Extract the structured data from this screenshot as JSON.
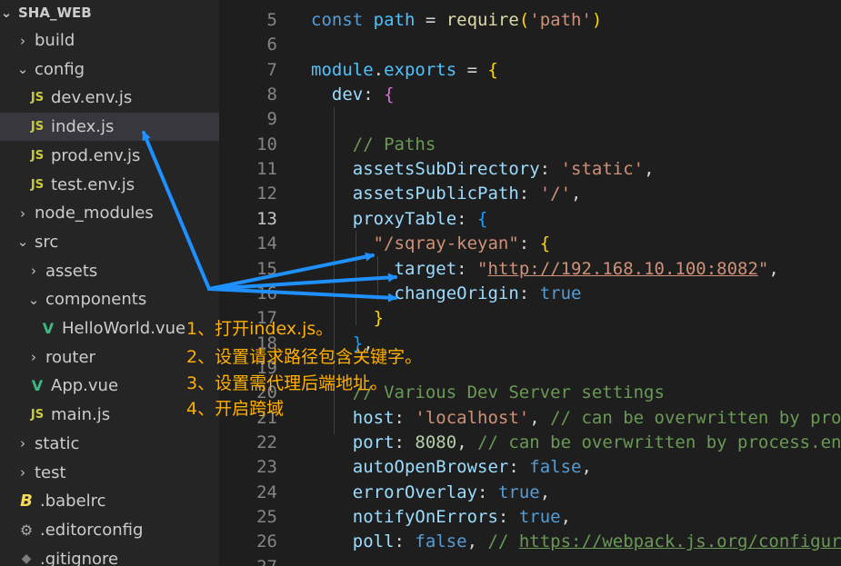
{
  "explorer": {
    "root": "SHA_WEB",
    "items": [
      {
        "label": "build",
        "type": "folder",
        "open": false,
        "indent": 0
      },
      {
        "label": "config",
        "type": "folder",
        "open": true,
        "indent": 0
      },
      {
        "label": "dev.env.js",
        "type": "js",
        "indent": 1
      },
      {
        "label": "index.js",
        "type": "js",
        "indent": 1,
        "selected": true
      },
      {
        "label": "prod.env.js",
        "type": "js",
        "indent": 1
      },
      {
        "label": "test.env.js",
        "type": "js",
        "indent": 1
      },
      {
        "label": "node_modules",
        "type": "folder",
        "open": false,
        "indent": 0
      },
      {
        "label": "src",
        "type": "folder",
        "open": true,
        "indent": 0
      },
      {
        "label": "assets",
        "type": "folder",
        "open": false,
        "indent": 1
      },
      {
        "label": "components",
        "type": "folder",
        "open": true,
        "indent": 1
      },
      {
        "label": "HelloWorld.vue",
        "type": "vue",
        "indent": 2
      },
      {
        "label": "router",
        "type": "folder",
        "open": false,
        "indent": 1
      },
      {
        "label": "App.vue",
        "type": "vue",
        "indent": 1
      },
      {
        "label": "main.js",
        "type": "js",
        "indent": 1
      },
      {
        "label": "static",
        "type": "folder",
        "open": false,
        "indent": 0
      },
      {
        "label": "test",
        "type": "folder",
        "open": false,
        "indent": 0
      },
      {
        "label": ".babelrc",
        "type": "babel",
        "indent": 0
      },
      {
        "label": ".editorconfig",
        "type": "gear",
        "indent": 0
      },
      {
        "label": ".gitignore",
        "type": "git",
        "indent": 0
      }
    ]
  },
  "editor": {
    "active_line": 13,
    "lines": [
      {
        "n": 5,
        "tokens": [
          [
            "kw",
            "const "
          ],
          [
            "var",
            "path"
          ],
          [
            "pun",
            " = "
          ],
          [
            "fn",
            "require"
          ],
          [
            "br1",
            "("
          ],
          [
            "str",
            "'path'"
          ],
          [
            "br1",
            ")"
          ]
        ]
      },
      {
        "n": 6,
        "tokens": []
      },
      {
        "n": 7,
        "tokens": [
          [
            "var",
            "module"
          ],
          [
            "pun",
            "."
          ],
          [
            "var",
            "exports"
          ],
          [
            "pun",
            " = "
          ],
          [
            "br1",
            "{"
          ]
        ]
      },
      {
        "n": 8,
        "tokens": [
          [
            "pun",
            "  "
          ],
          [
            "prop",
            "dev"
          ],
          [
            "pun",
            ": "
          ],
          [
            "br2",
            "{"
          ]
        ]
      },
      {
        "n": 9,
        "tokens": []
      },
      {
        "n": 10,
        "tokens": [
          [
            "pun",
            "    "
          ],
          [
            "cmt",
            "// Paths"
          ]
        ]
      },
      {
        "n": 11,
        "tokens": [
          [
            "pun",
            "    "
          ],
          [
            "prop",
            "assetsSubDirectory"
          ],
          [
            "pun",
            ": "
          ],
          [
            "str",
            "'static'"
          ],
          [
            "pun",
            ","
          ]
        ]
      },
      {
        "n": 12,
        "tokens": [
          [
            "pun",
            "    "
          ],
          [
            "prop",
            "assetsPublicPath"
          ],
          [
            "pun",
            ": "
          ],
          [
            "str",
            "'/'"
          ],
          [
            "pun",
            ","
          ]
        ]
      },
      {
        "n": 13,
        "tokens": [
          [
            "pun",
            "    "
          ],
          [
            "prop",
            "proxyTable"
          ],
          [
            "pun",
            ": "
          ],
          [
            "br3",
            "{"
          ]
        ]
      },
      {
        "n": 14,
        "tokens": [
          [
            "pun",
            "      "
          ],
          [
            "str",
            "\"/sqray-keyan\""
          ],
          [
            "pun",
            ": "
          ],
          [
            "br1",
            "{"
          ]
        ]
      },
      {
        "n": 15,
        "tokens": [
          [
            "pun",
            "        "
          ],
          [
            "prop",
            "target"
          ],
          [
            "pun",
            ": "
          ],
          [
            "str",
            "\""
          ],
          [
            "str url",
            "http://192.168.10.100:8082"
          ],
          [
            "str",
            "\""
          ],
          [
            "pun",
            ","
          ]
        ]
      },
      {
        "n": 16,
        "tokens": [
          [
            "pun",
            "        "
          ],
          [
            "prop",
            "changeOrigin"
          ],
          [
            "pun",
            ": "
          ],
          [
            "kw",
            "true"
          ]
        ]
      },
      {
        "n": 17,
        "tokens": [
          [
            "pun",
            "      "
          ],
          [
            "br1",
            "}"
          ]
        ]
      },
      {
        "n": 18,
        "tokens": [
          [
            "pun",
            "    "
          ],
          [
            "br3",
            "}"
          ],
          [
            "pun",
            ","
          ]
        ]
      },
      {
        "n": 19,
        "tokens": []
      },
      {
        "n": 20,
        "tokens": [
          [
            "pun",
            "    "
          ],
          [
            "cmt",
            "// Various Dev Server settings"
          ]
        ]
      },
      {
        "n": 21,
        "tokens": [
          [
            "pun",
            "    "
          ],
          [
            "prop",
            "host"
          ],
          [
            "pun",
            ": "
          ],
          [
            "str",
            "'localhost'"
          ],
          [
            "pun",
            ", "
          ],
          [
            "cmt",
            "// can be overwritten by process.env.HOST"
          ]
        ]
      },
      {
        "n": 22,
        "tokens": [
          [
            "pun",
            "    "
          ],
          [
            "prop",
            "port"
          ],
          [
            "pun",
            ": "
          ],
          [
            "num",
            "8080"
          ],
          [
            "pun",
            ", "
          ],
          [
            "cmt",
            "// can be overwritten by process.env.PORT"
          ]
        ]
      },
      {
        "n": 23,
        "tokens": [
          [
            "pun",
            "    "
          ],
          [
            "prop",
            "autoOpenBrowser"
          ],
          [
            "pun",
            ": "
          ],
          [
            "kw",
            "false"
          ],
          [
            "pun",
            ","
          ]
        ]
      },
      {
        "n": 24,
        "tokens": [
          [
            "pun",
            "    "
          ],
          [
            "prop",
            "errorOverlay"
          ],
          [
            "pun",
            ": "
          ],
          [
            "kw",
            "true"
          ],
          [
            "pun",
            ","
          ]
        ]
      },
      {
        "n": 25,
        "tokens": [
          [
            "pun",
            "    "
          ],
          [
            "prop",
            "notifyOnErrors"
          ],
          [
            "pun",
            ": "
          ],
          [
            "kw",
            "true"
          ],
          [
            "pun",
            ","
          ]
        ]
      },
      {
        "n": 26,
        "tokens": [
          [
            "pun",
            "    "
          ],
          [
            "prop",
            "poll"
          ],
          [
            "pun",
            ": "
          ],
          [
            "kw",
            "false"
          ],
          [
            "pun",
            ", "
          ],
          [
            "cmt",
            "// "
          ],
          [
            "cmt url",
            "https://webpack.js.org/configuration/"
          ]
        ]
      },
      {
        "n": 27,
        "tokens": []
      }
    ]
  },
  "annotations": [
    "1、打开index.js。",
    "2、设置请求路径包含关键字。",
    "3、设置需代理后端地址。",
    "4、开启跨域"
  ],
  "colors": {
    "arrow": "#1e90ff",
    "note": "#ffb000"
  }
}
